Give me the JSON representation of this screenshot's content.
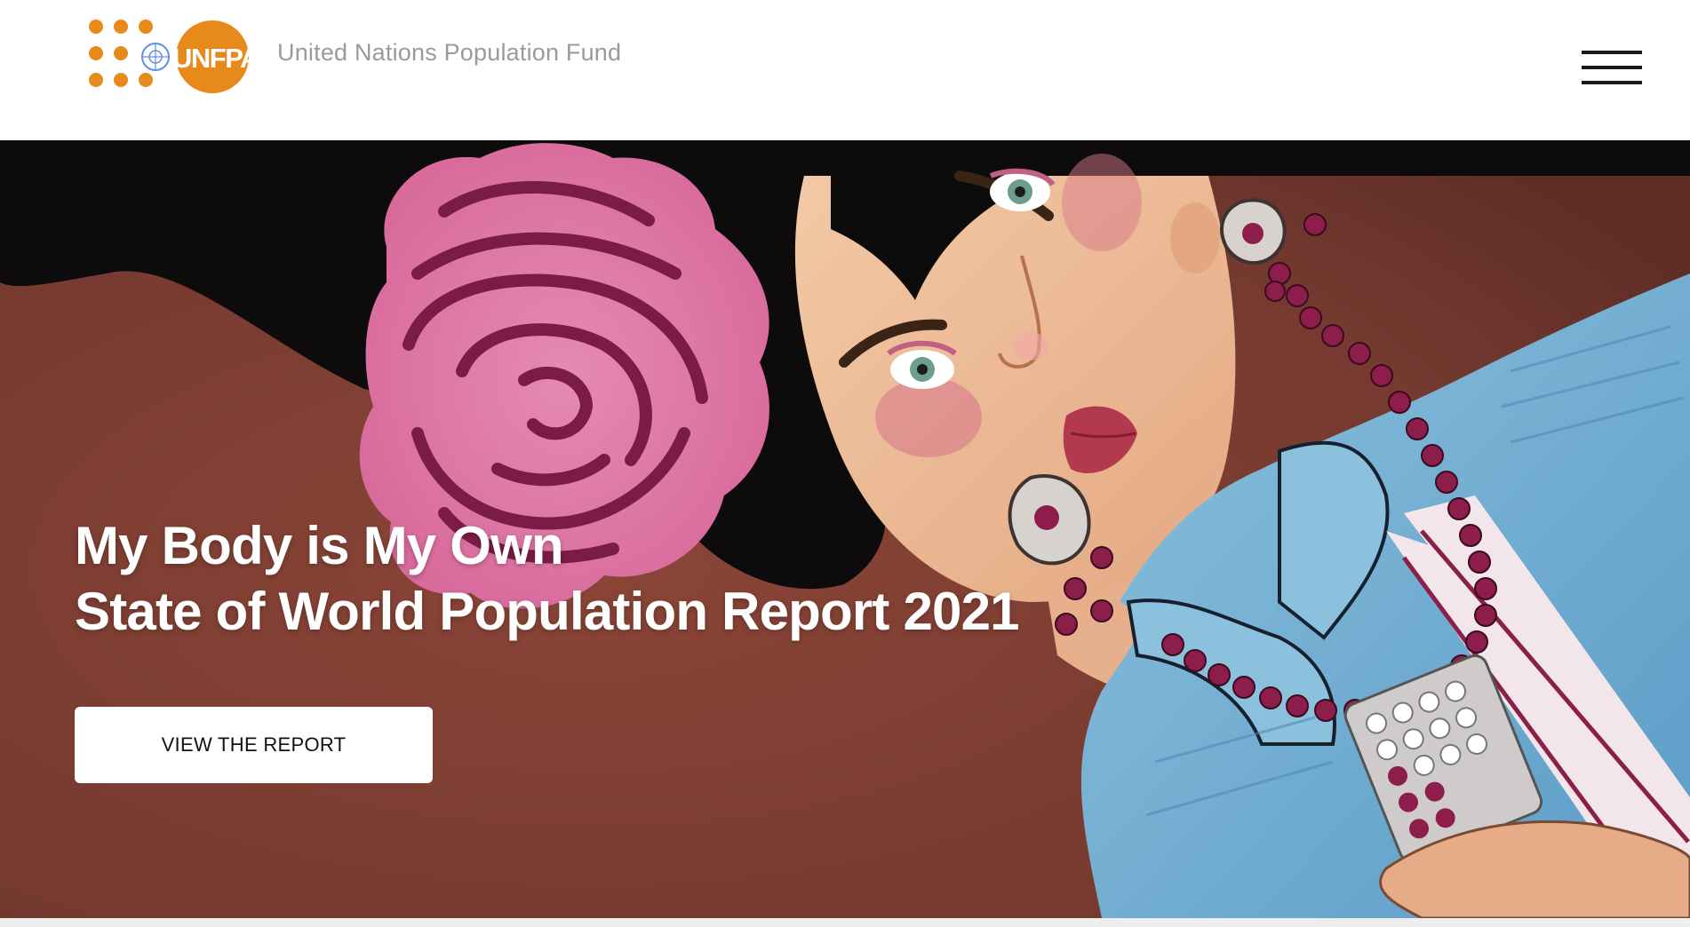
{
  "header": {
    "logo_text": "UNFPA",
    "org_name": "United Nations Population Fund",
    "menu_icon": "hamburger-menu-icon"
  },
  "hero": {
    "title_line1": "My Body is My Own",
    "title_line2": "State of World Population Report 2021",
    "cta_label": "VIEW THE REPORT",
    "illustration": "woman-with-rose-illustration"
  },
  "colors": {
    "brand_orange": "#E8891C",
    "org_name_gray": "#9A9A9A",
    "hero_background": "#7B3B31",
    "cta_background": "#FFFFFF"
  }
}
